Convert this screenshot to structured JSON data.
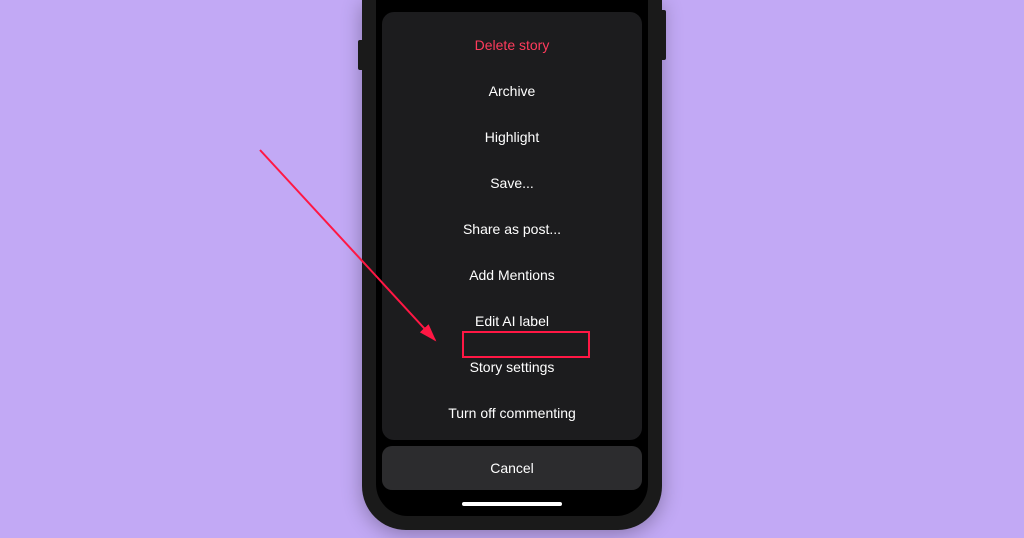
{
  "menu": {
    "items": [
      {
        "label": "Delete story",
        "destructive": true
      },
      {
        "label": "Archive",
        "destructive": false
      },
      {
        "label": "Highlight",
        "destructive": false
      },
      {
        "label": "Save...",
        "destructive": false
      },
      {
        "label": "Share as post...",
        "destructive": false
      },
      {
        "label": "Add Mentions",
        "destructive": false
      },
      {
        "label": "Edit AI label",
        "destructive": false
      },
      {
        "label": "Story settings",
        "destructive": false
      },
      {
        "label": "Turn off commenting",
        "destructive": false
      }
    ],
    "cancel_label": "Cancel"
  },
  "annotation": {
    "highlighted_item": "Story settings",
    "arrow_color": "#ff1744"
  }
}
